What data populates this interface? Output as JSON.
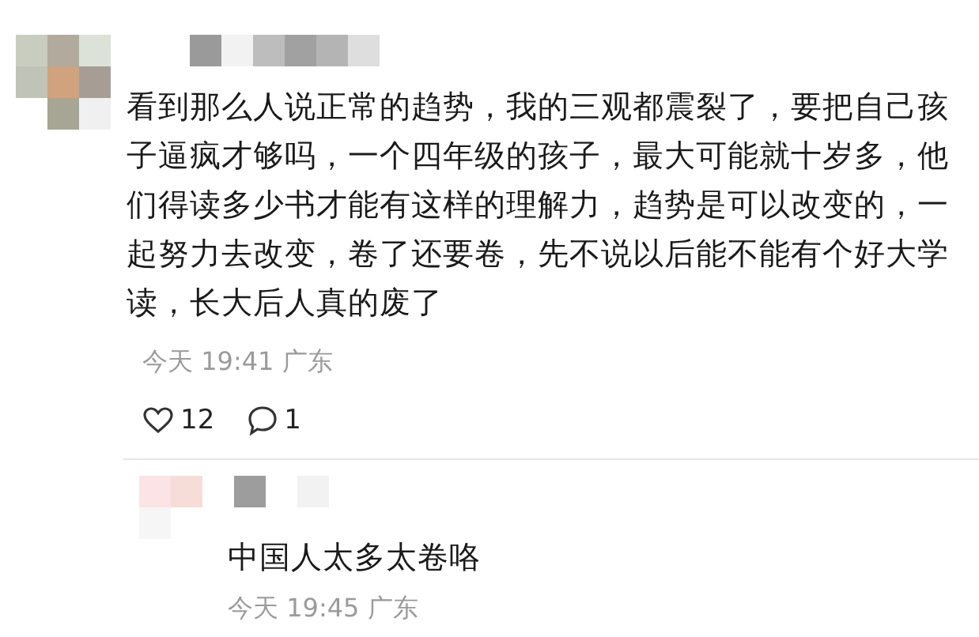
{
  "comment": {
    "text": "看到那么人说正常的趋势，我的三观都震裂了，要把自己孩子逼疯才够吗，一个四年级的孩子，最大可能就十岁多，他们得读多少书才能有这样的理解力，趋势是可以改变的，一起努力去改变，卷了还要卷，先不说以后能不能有个好大学读，长大后人真的废了",
    "time": "今天 19:41 广东",
    "likes": "12",
    "replies": "1"
  },
  "reply": {
    "text": "中国人太多太卷咯",
    "time": "今天 19:45 广东"
  }
}
